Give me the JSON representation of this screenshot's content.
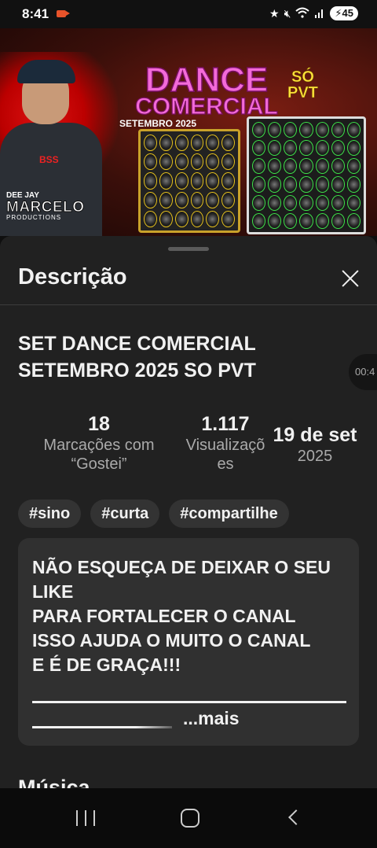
{
  "status_bar": {
    "time": "8:41",
    "battery": "45",
    "icons": [
      "recording-icon",
      "star-icon",
      "mute-icon",
      "wifi-icon",
      "signal-icon",
      "battery-icon"
    ]
  },
  "thumbnail": {
    "title_line1": "DANCE",
    "title_line2": "COMERCIAL",
    "subtitle": "SETEMBRO 2025",
    "so": "SÓ",
    "pvt": "PVT",
    "brand_top": "DEE JAY",
    "brand_name": "MARCELO",
    "brand_sub": "PRODUCTIONS",
    "shirt_text": "BSS"
  },
  "sheet": {
    "title": "Descrição",
    "video_title": "SET DANCE COMERCIAL SETEMBRO 2025 SO PVT",
    "time_chip": "00:4",
    "stats": {
      "likes_value": "18",
      "likes_label_1": "Marcações com",
      "likes_label_2": "“Gostei”",
      "views_value": "1.117",
      "views_label_1": "Visualizaçõ",
      "views_label_2": "es",
      "date_value": "19 de set",
      "date_year": "2025"
    },
    "tags": [
      "#sino",
      "#curta",
      "#compartilhe"
    ],
    "description_lines": [
      "NÃO ESQUEÇA DE DEIXAR O SEU",
      "LIKE",
      "PARA FORTALECER O CANAL",
      "ISSO AJUDA O MUITO O CANAL",
      "E É DE GRAÇA!!!"
    ],
    "more_label": "...mais",
    "next_section": "Música"
  },
  "colors": {
    "background": "#0f0f0f",
    "sheet": "#212121",
    "description_box": "#303030",
    "chip": "#333333",
    "title_pink": "#f36ad8",
    "pvt_yellow": "#ffe23a"
  }
}
